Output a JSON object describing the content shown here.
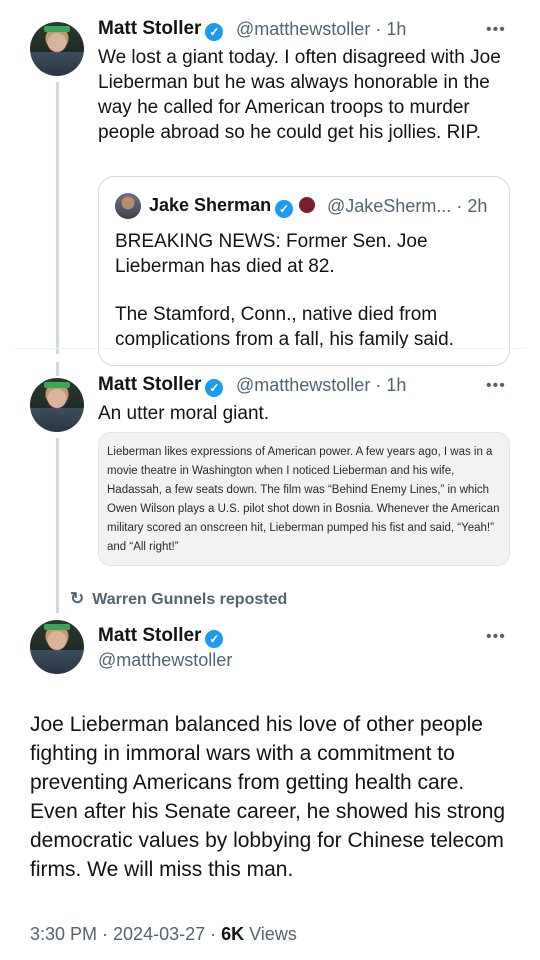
{
  "tweet1": {
    "name": "Matt Stoller",
    "handle": "@matthewstoller",
    "time": "· 1h",
    "more": "•••",
    "text": "We lost a giant today. I often disagreed with Joe Lieberman but he was always honorable in the way he called for American troops to murder people abroad so he could get his jollies. RIP.",
    "quote": {
      "name": "Jake Sherman",
      "handle": "@JakeSherm...",
      "time": "· 2h",
      "text1": "BREAKING NEWS: Former Sen. Joe Lieberman has died at 82.",
      "text2": "The Stamford, Conn., native died from complications from a fall, his family said."
    }
  },
  "tweet2": {
    "name": "Matt Stoller",
    "handle": "@matthewstoller",
    "time": "· 1h",
    "more": "•••",
    "text": "An utter moral giant.",
    "image_text": "Lieberman likes expressions of American power. A few years ago, I was in a movie theatre in Washington when I noticed Lieberman and his wife, Hadassah, a few seats down. The film was “Behind Enemy Lines,” in which Owen Wilson plays a U.S. pilot shot down in Bosnia. Whenever the American military scored an onscreen hit, Lieberman pumped his fist and said, “Yeah!” and “All right!”"
  },
  "repost": {
    "icon": "↻",
    "label": "Warren Gunnels reposted"
  },
  "tweet3": {
    "name": "Matt Stoller",
    "handle": "@matthewstoller",
    "more": "•••",
    "text": "Joe Lieberman balanced his love of other people fighting in immoral wars with a commitment to preventing Americans from getting health care. Even after his Senate career, he showed his strong democratic values by lobbying for Chinese telecom firms. We will miss this man.",
    "meta_time": "3:30 PM · 2024-03-27 · ",
    "views_count": "6K",
    "views_label": " Views"
  },
  "colors": {
    "verified": "#1d9bf0",
    "secondary_text": "#536471",
    "border": "#cfd9de"
  },
  "icons": [
    "verified-badge-icon",
    "more-icon",
    "repost-icon"
  ]
}
